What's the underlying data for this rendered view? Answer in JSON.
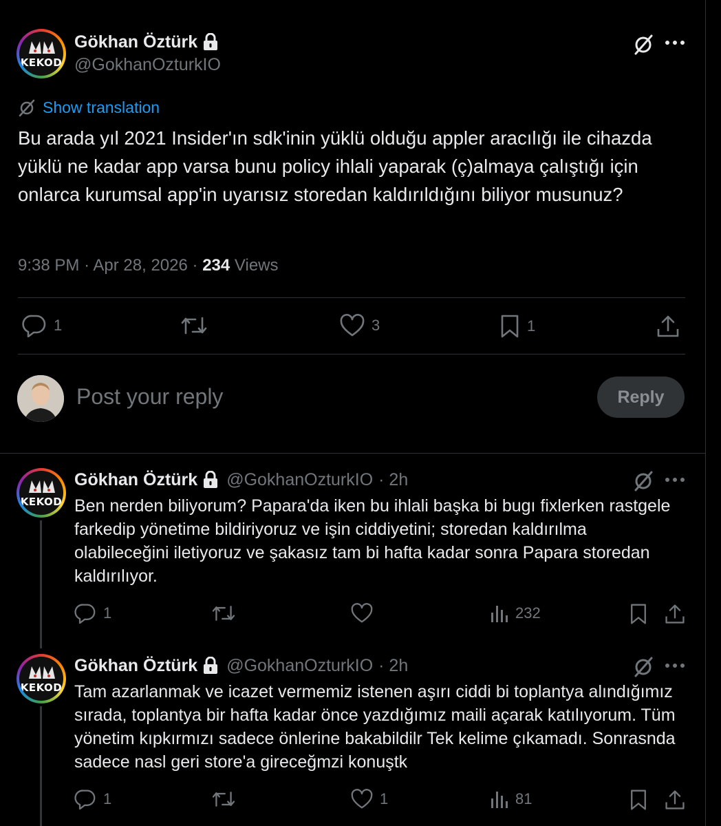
{
  "main_post": {
    "author_name": "Gökhan Öztürk",
    "author_handle": "@GokhanOzturkIO",
    "avatar_text": "KEKOD",
    "show_translation": "Show translation",
    "text": "Bu arada yıl 2021 Insider'ın sdk'inin yüklü olduğu appler aracılığı ile cihazda yüklü ne kadar app varsa bunu policy ihlali yaparak (ç)almaya çalıştığı için onlarca kurumsal app'in uyarısız storedan kaldırıldığını biliyor musunuz?",
    "time": "9:38 PM",
    "date": "Apr 28, 2026",
    "views_count": "234",
    "views_label": "Views",
    "replies": "1",
    "likes": "3",
    "bookmarks": "1"
  },
  "composer": {
    "placeholder": "Post your reply",
    "button_label": "Reply"
  },
  "replies": [
    {
      "author_name": "Gökhan Öztürk",
      "author_handle": "@GokhanOzturkIO",
      "time_ago": "· 2h",
      "avatar_text": "KEKOD",
      "text": "Ben nerden biliyorum? Papara'da iken bu ihlali başka bi bugı fixlerken rastgele farkedip yönetime bildiriyoruz ve işin ciddiyetini; storedan kaldırılma olabileceğini iletiyoruz ve şakasız tam bi hafta kadar sonra Papara storedan kaldırılıyor.",
      "reply_count": "1",
      "like_count": "",
      "view_count": "232"
    },
    {
      "author_name": "Gökhan Öztürk",
      "author_handle": "@GokhanOzturkIO",
      "time_ago": "· 2h",
      "avatar_text": "KEKOD",
      "text": "Tam azarlanmak ve icazet vermemiz istenen aşırı ciddi bi toplantya alındığımız sırada, toplantya bir hafta kadar önce yazdığımız maili açarak katılıyorum. Tüm yönetim kıpkırmızı sadece önlerine bakabildilr Tek kelime çıkamadı. Sonrasnda sadece nasl geri store'a gireceğmzi konuştk",
      "reply_count": "1",
      "like_count": "1",
      "view_count": "81"
    }
  ],
  "colors": {
    "background": "#000000",
    "text": "#e7e9ea",
    "muted": "#71767b",
    "link": "#1d9bf0",
    "divider": "#2f3336"
  }
}
